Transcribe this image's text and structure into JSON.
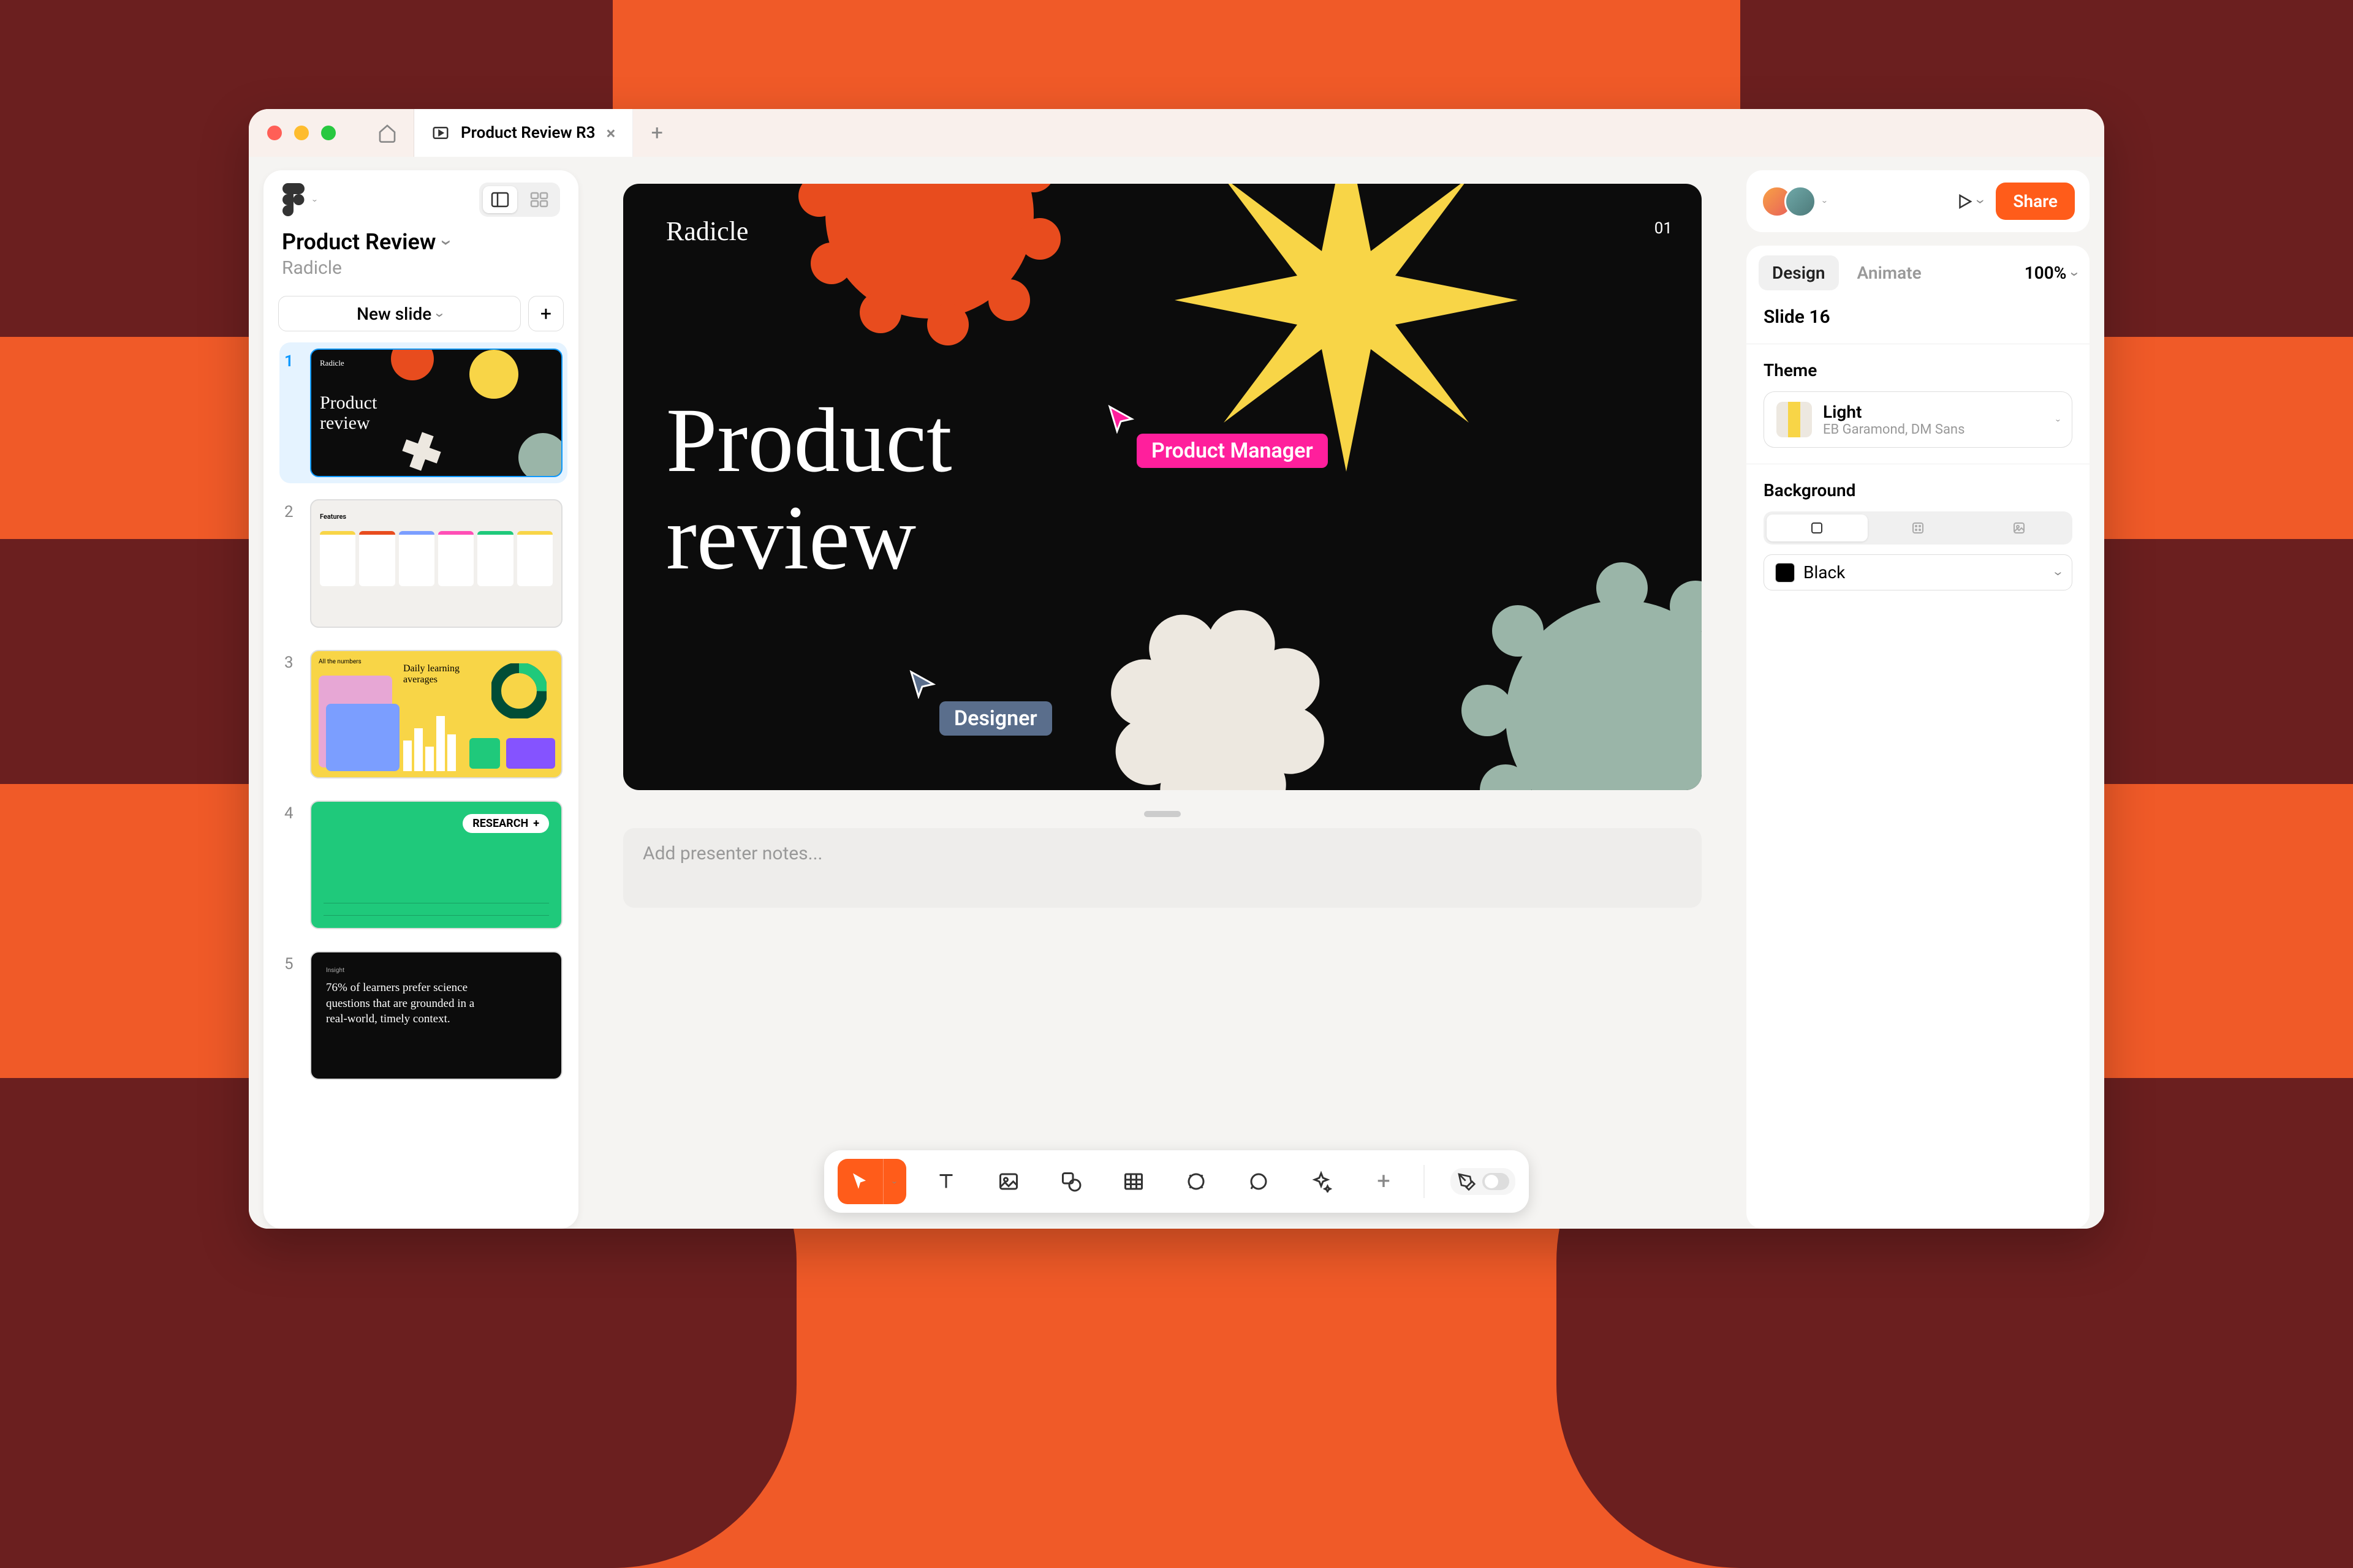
{
  "tab_title": "Product Review R3",
  "sidebar": {
    "title": "Product Review",
    "subtitle": "Radicle",
    "new_slide_label": "New slide"
  },
  "thumbnails": {
    "count": 5,
    "slide4_tag": "RESEARCH",
    "slide5_text": "76% of learners prefer science questions that are grounded in a real-world, timely context."
  },
  "slide": {
    "brand": "Radicle",
    "page_num": "01",
    "title_line1": "Product",
    "title_line2": "review",
    "cursor_pm": "Product Manager",
    "cursor_designer": "Designer"
  },
  "notes": {
    "placeholder": "Add presenter notes..."
  },
  "right_panel": {
    "share_label": "Share",
    "tab_design": "Design",
    "tab_animate": "Animate",
    "zoom": "100%",
    "slide_label": "Slide 16",
    "theme_header": "Theme",
    "theme_name": "Light",
    "theme_fonts": "EB Garamond, DM Sans",
    "background_header": "Background",
    "bg_color": "Black"
  },
  "colors": {
    "accent": "#FF5C1A",
    "cursor_pm": "#FF1F9C",
    "cursor_designer": "#5A6E8C"
  }
}
